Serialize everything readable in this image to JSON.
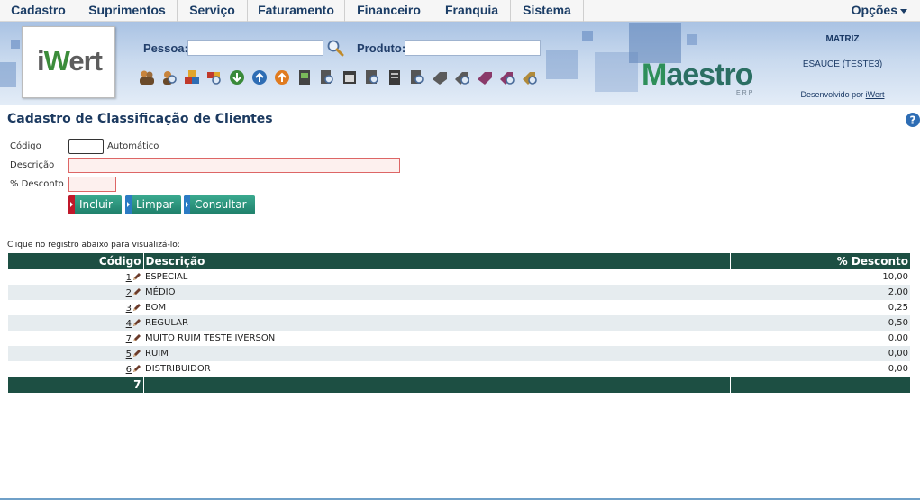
{
  "menu": {
    "items": [
      "Cadastro",
      "Suprimentos",
      "Serviço",
      "Faturamento",
      "Financeiro",
      "Franquia",
      "Sistema"
    ],
    "options_label": "Opções"
  },
  "header": {
    "logo_prefix": "i",
    "logo_w": "W",
    "logo_suffix": "ert",
    "pessoa_label": "Pessoa:",
    "pessoa_value": "",
    "produto_label": "Produto:",
    "produto_value": "",
    "brand_m": "M",
    "brand_rest": "aestro",
    "brand_sub": "ERP",
    "company": "MATRIZ",
    "user": "ESAUCE (TESTE3)",
    "developed_by": "Desenvolvido por",
    "developer": "iWert",
    "toolbar_icons": [
      "people-icon",
      "search-person-icon",
      "boxes-icon",
      "search-boxes-icon",
      "down-arrow-icon",
      "up-arrow-icon",
      "cart-icon",
      "invoice-icon",
      "search-invoice-icon",
      "calendar-icon",
      "document-icon",
      "search-document-icon",
      "tag-icon",
      "search-tag-icon",
      "book-icon",
      "search-book-icon",
      "settings-tag-icon"
    ]
  },
  "page": {
    "title": "Cadastro de Classificação de Clientes",
    "help_icon": "help-icon"
  },
  "form": {
    "codigo_label": "Código",
    "codigo_value": "",
    "auto_label": "Automático",
    "descricao_label": "Descrição",
    "descricao_value": "",
    "desconto_label": "% Desconto",
    "desconto_value": "",
    "buttons": {
      "incluir": "Incluir",
      "limpar": "Limpar",
      "consultar": "Consultar"
    },
    "colors": {
      "incluir_tab": "#c0182a",
      "limpar_tab": "#2b7bc4",
      "consultar_tab": "#2b7bc4",
      "button_body": "#1f7f6a"
    }
  },
  "grid": {
    "hint": "Clique no registro abaixo para visualizá-lo:",
    "headers": {
      "codigo": "Código",
      "descricao": "Descrição",
      "desconto": "% Desconto"
    },
    "rows": [
      {
        "codigo": "1",
        "descricao": "ESPECIAL",
        "desconto": "10,00"
      },
      {
        "codigo": "2",
        "descricao": "MÉDIO",
        "desconto": "2,00"
      },
      {
        "codigo": "3",
        "descricao": "BOM",
        "desconto": "0,25"
      },
      {
        "codigo": "4",
        "descricao": "REGULAR",
        "desconto": "0,50"
      },
      {
        "codigo": "7",
        "descricao": "MUITO RUIM TESTE IVERSON",
        "desconto": "0,00"
      },
      {
        "codigo": "5",
        "descricao": "RUIM",
        "desconto": "0,00"
      },
      {
        "codigo": "6",
        "descricao": "DISTRIBUIDOR",
        "desconto": "0,00"
      }
    ],
    "total_count": "7",
    "header_color": "#1d4f43"
  }
}
